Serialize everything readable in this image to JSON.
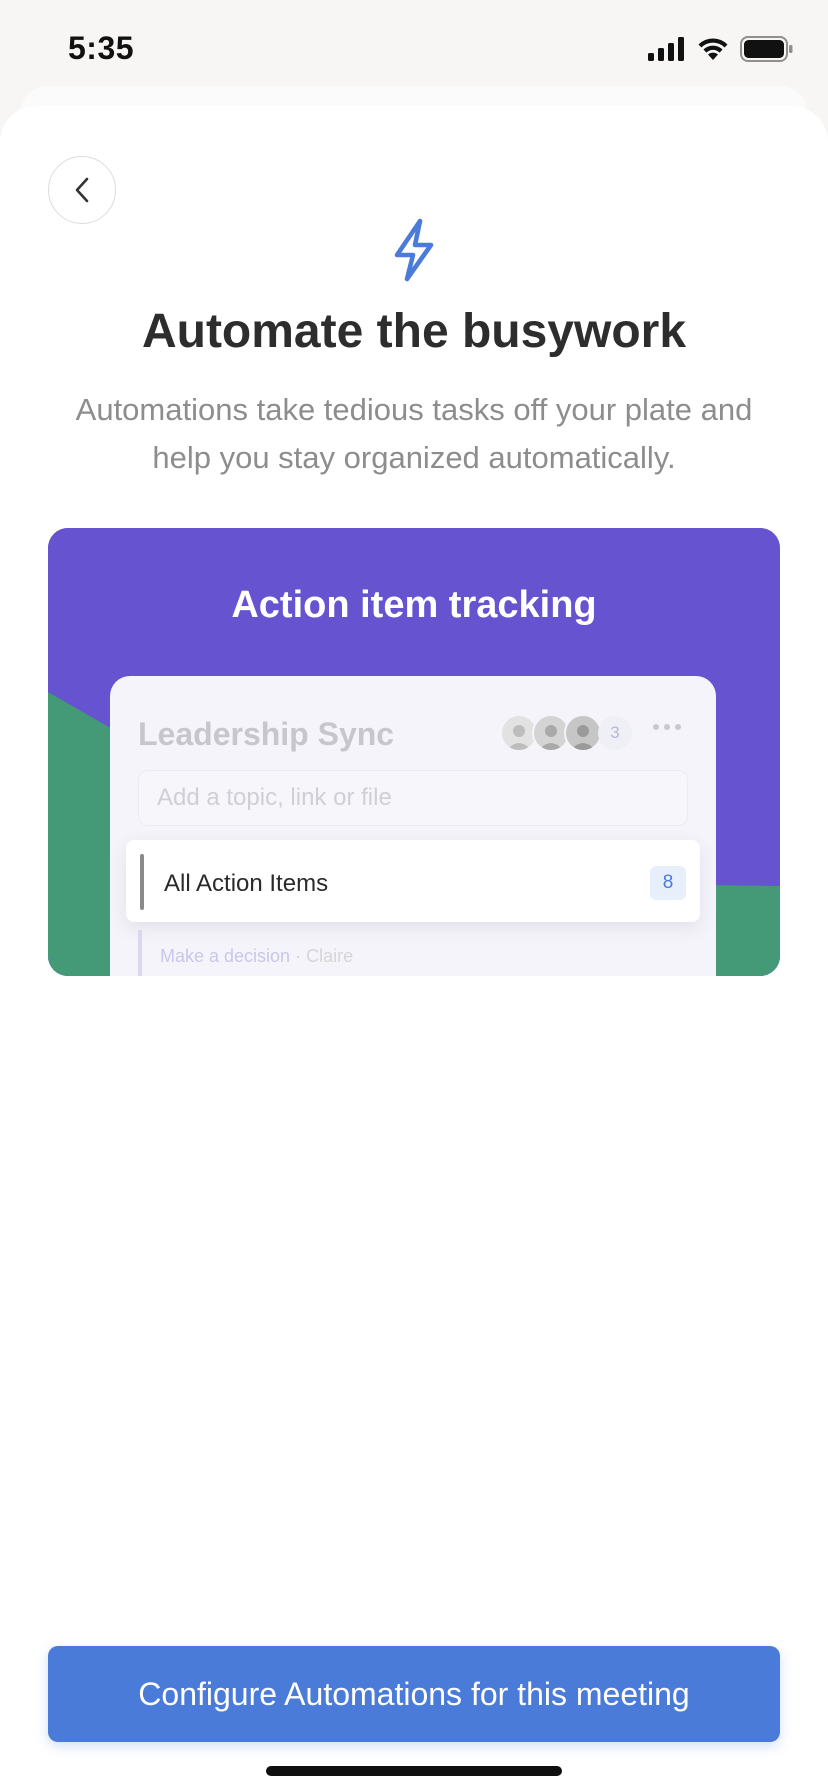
{
  "status_bar": {
    "time": "5:35"
  },
  "header": {
    "title": "Automate the busywork",
    "subtitle": "Automations take tedious tasks off your plate and help you stay organized automatically."
  },
  "feature_card": {
    "title": "Action item tracking",
    "colors": {
      "background": "#6553cf",
      "accent": "#449977"
    },
    "mock": {
      "meeting_title": "Leadership Sync",
      "attendee_overflow": "3",
      "topic_placeholder": "Add a topic, link or file",
      "action_row": {
        "label": "All Action Items",
        "count": "8"
      },
      "sub_item": {
        "text": "Make a decision",
        "separator": " · ",
        "person": "Claire"
      }
    }
  },
  "cta": {
    "label": "Configure Automations for this meeting",
    "color": "#4a7bd9"
  },
  "icons": {
    "back": "chevron-left-icon",
    "feature": "lightning-bolt-icon",
    "more": "more-horizontal-icon"
  }
}
